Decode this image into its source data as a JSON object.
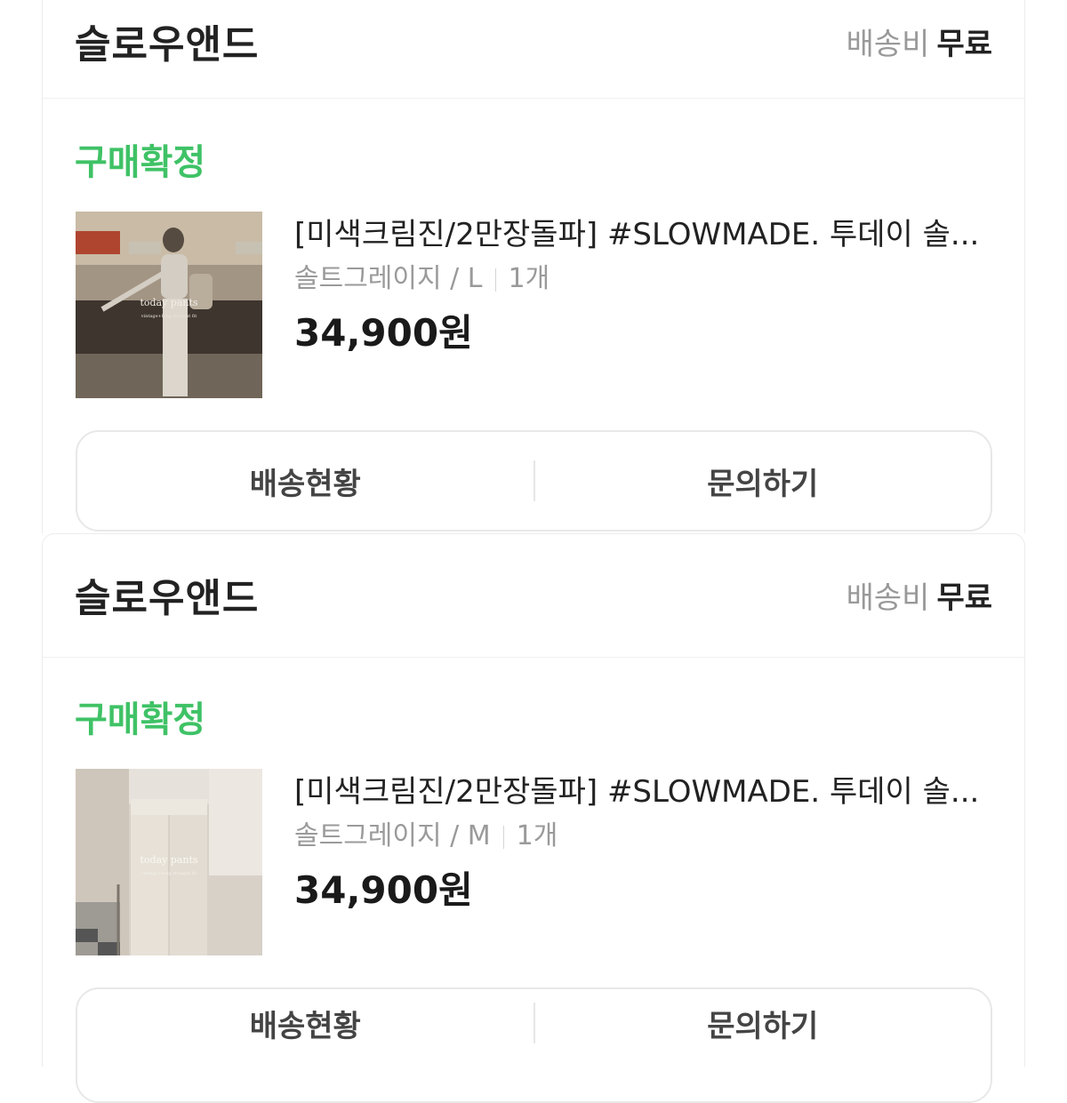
{
  "orders": [
    {
      "store_name": "슬로우앤드",
      "shipping_label": "배송비",
      "shipping_fee": "무료",
      "status": "구매확정",
      "product_name": "[미색크림진/2만장돌파] #SLOWMADE. 투데이 솔...",
      "option": "솔트그레이지 / L",
      "quantity": "1개",
      "price": "34,900원",
      "thumbnail_caption": "today pants",
      "thumbnail_subcaption": "vintage+long straight fit",
      "button_track": "배송현황",
      "button_inquiry": "문의하기"
    },
    {
      "store_name": "슬로우앤드",
      "shipping_label": "배송비",
      "shipping_fee": "무료",
      "status": "구매확정",
      "product_name": "[미색크림진/2만장돌파] #SLOWMADE. 투데이 솔...",
      "option": "솔트그레이지 / M",
      "quantity": "1개",
      "price": "34,900원",
      "thumbnail_caption": "today pants",
      "thumbnail_subcaption": "vintage+long straight fit",
      "button_track": "배송현황",
      "button_inquiry": "문의하기"
    }
  ],
  "colors": {
    "status_green": "#3fc266",
    "muted_text": "#999999",
    "primary_text": "#222222"
  }
}
